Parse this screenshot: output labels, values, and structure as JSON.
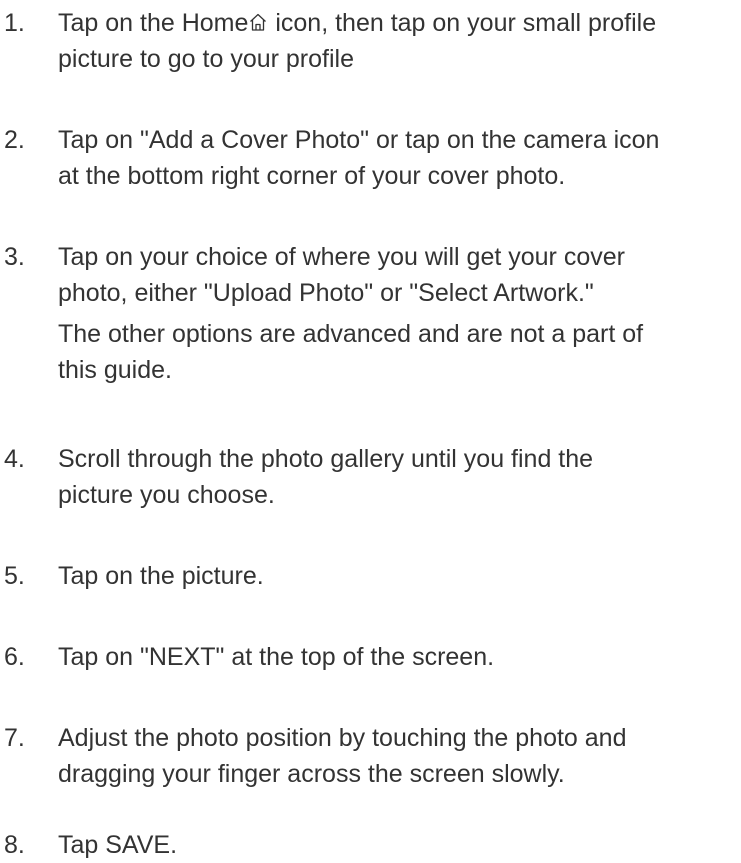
{
  "steps": [
    {
      "number": "1.",
      "text_before_icon": "Tap on the Home",
      "icon": "home-icon",
      "text_after_icon": " icon, then tap on your small profile",
      "text_line2": "picture to go to your profile"
    },
    {
      "number": "2.",
      "text": "Tap on \"Add a Cover Photo\" or tap on the camera icon\nat the bottom right corner of your cover photo."
    },
    {
      "number": "3.",
      "text": "Tap on your choice of where you will get your cover\nphoto, either \"Upload Photo\" or \"Select Artwork.\"",
      "note": "The other options are advanced and are not a part of\nthis guide."
    },
    {
      "number": "4.",
      "text": "Scroll through the photo gallery until you find the\npicture you choose."
    },
    {
      "number": "5.",
      "text": "Tap on the picture."
    },
    {
      "number": "6.",
      "text": "Tap on \"NEXT\" at the top of the screen."
    },
    {
      "number": "7.",
      "text": "Adjust the photo position by touching the photo and\ndragging your finger across the screen slowly."
    },
    {
      "number": "8.",
      "text": "Tap SAVE."
    }
  ]
}
